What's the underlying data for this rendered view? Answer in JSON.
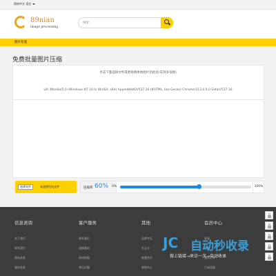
{
  "topbar": {
    "language": "简体中文 语言"
  },
  "brand": {
    "name": "89nian",
    "tagline": "image processing"
  },
  "search": {
    "placeholder": "搜索"
  },
  "nav": {
    "items": [
      {
        "label": "图片处理"
      }
    ]
  },
  "main": {
    "title": "免费批量图片压缩",
    "hint": "点击下面选择文件或者拖拽本地图片到此处(支持多张图)",
    "user_agent": "UA: Mozilla/5.0 (Windows NT 10.0; Win64; x64) AppleWebKit/537.36 (KHTML, like Gecko) Chrome/113.0.0.0 Safari/537.36"
  },
  "upload": {
    "button_label": "选择文件",
    "status": "未选择任何文件"
  },
  "quality": {
    "label": "压缩率",
    "value": "60%",
    "min_label": "0%",
    "max_label": "100%",
    "slider_fraction": 0.6
  },
  "footer": {
    "columns": [
      {
        "title": "信息咨询",
        "links": [
          "关于我们",
          "联系我们",
          "隐私条款",
          "服务条款"
        ]
      },
      {
        "title": "客户服务",
        "links": [
          "联系我们",
          "退换服务",
          "网站地图",
          "常见问题"
        ]
      },
      {
        "title": "其他",
        "links": [
          "品牌专区",
          "礼品卡",
          "联盟合作",
          "帮助中心"
        ]
      },
      {
        "title": "会员中心",
        "links": [
          "登录",
          "注册",
          "我的订单",
          "已阅读版"
        ]
      }
    ]
  },
  "watermark": {
    "logo": "JC",
    "text": "自动秒收录",
    "subtitle": "做上链接→来访一次→自动收录"
  },
  "colors": {
    "accent": "#fed000",
    "brand_orange": "#f0a519",
    "slider_blue": "#1e88e5",
    "footer_bg": "#3c3c3c"
  }
}
